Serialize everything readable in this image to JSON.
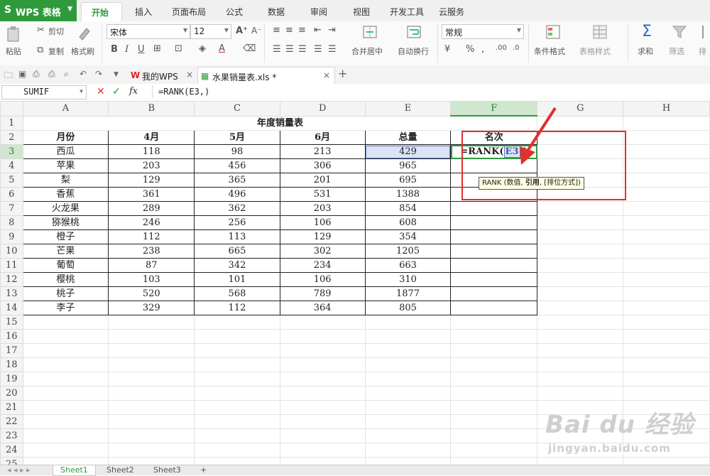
{
  "app": {
    "logo": "S",
    "title": "WPS 表格"
  },
  "menu": {
    "tabs": [
      "开始",
      "插入",
      "页面布局",
      "公式",
      "数据",
      "审阅",
      "视图",
      "开发工具",
      "云服务"
    ],
    "active": "开始"
  },
  "ribbon": {
    "cut": "剪切",
    "copy": "复制",
    "paste": "粘贴",
    "format_painter": "格式刷",
    "font_name": "宋体",
    "font_size": "12",
    "merge_center": "合并居中",
    "wrap_text": "自动换行",
    "number_format": "常规",
    "cond_format": "条件格式",
    "table_style": "表格样式",
    "sum": "求和",
    "filter": "筛选",
    "sort": "排"
  },
  "docbar": {
    "tabs": [
      {
        "label": "我的WPS"
      },
      {
        "label": "水果销量表.xls *"
      }
    ]
  },
  "formula_bar": {
    "name_box": "SUMIF",
    "formula": "=RANK(E3,)"
  },
  "columns": [
    "A",
    "B",
    "C",
    "D",
    "E",
    "F",
    "G",
    "H"
  ],
  "selected_column": "F",
  "sheet": {
    "title": "年度销量表",
    "headers": [
      "月份",
      "4月",
      "5月",
      "6月",
      "总量",
      "名次"
    ],
    "rows": [
      [
        "西瓜",
        "118",
        "98",
        "213",
        "429"
      ],
      [
        "苹果",
        "203",
        "456",
        "306",
        "965"
      ],
      [
        "梨",
        "129",
        "365",
        "201",
        "695"
      ],
      [
        "香蕉",
        "361",
        "496",
        "531",
        "1388"
      ],
      [
        "火龙果",
        "289",
        "362",
        "203",
        "854"
      ],
      [
        "猕猴桃",
        "246",
        "256",
        "106",
        "608"
      ],
      [
        "橙子",
        "112",
        "113",
        "129",
        "354"
      ],
      [
        "芒果",
        "238",
        "665",
        "302",
        "1205"
      ],
      [
        "葡萄",
        "87",
        "342",
        "234",
        "663"
      ],
      [
        "樱桃",
        "103",
        "101",
        "106",
        "310"
      ],
      [
        "桃子",
        "520",
        "568",
        "789",
        "1877"
      ],
      [
        "李子",
        "329",
        "112",
        "364",
        "805"
      ]
    ],
    "editing_cell": {
      "prefix": "=RANK(",
      "ref": "E3",
      "suffix": ",)"
    },
    "row_count": 25
  },
  "tooltip": {
    "fn": "RANK",
    "open": " (数值, ",
    "bold": "引用",
    "rest": ", [排位方式])"
  },
  "sheet_tabs": [
    "Sheet1",
    "Sheet2",
    "Sheet3"
  ],
  "watermark": {
    "line1": "Bai du 经验",
    "line2": "jingyan.baidu.com"
  },
  "colors": {
    "accent": "#2f9a3c",
    "highlight_box": "#e03030",
    "selection": "#dce3f5"
  }
}
